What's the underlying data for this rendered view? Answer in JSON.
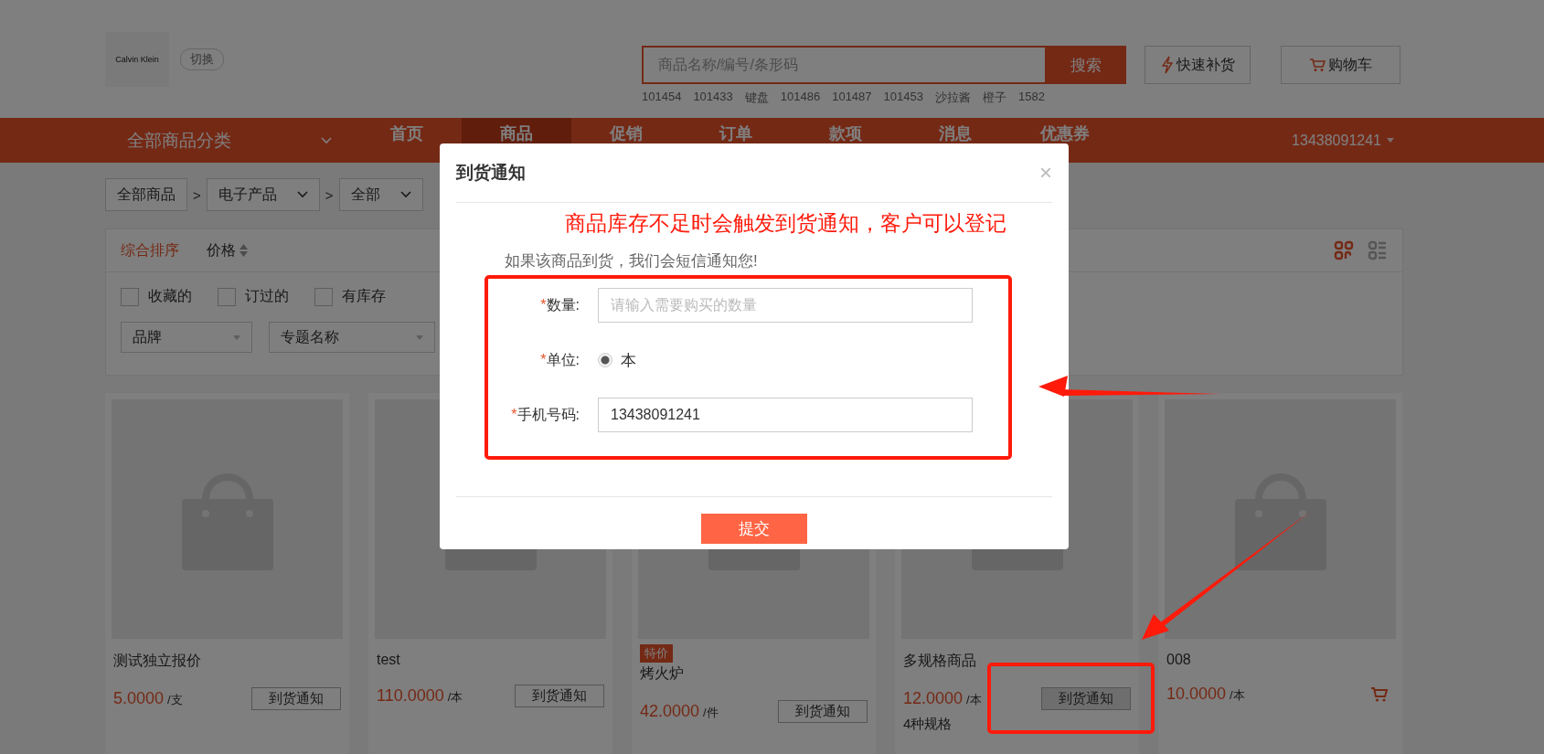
{
  "header": {
    "logo": "Calvin Klein",
    "switch_label": "切换",
    "search": {
      "placeholder": "商品名称/编号/条形码",
      "button": "搜索"
    },
    "quick_restock": "快速补货",
    "cart": "购物车",
    "hot_words": [
      "101454",
      "101433",
      "键盘",
      "101486",
      "101487",
      "101453",
      "沙拉酱",
      "橙子",
      "1582"
    ]
  },
  "nav": {
    "category": "全部商品分类",
    "items": [
      {
        "label": "首页",
        "selected": false
      },
      {
        "label": "商品",
        "selected": true
      },
      {
        "label": "促销",
        "selected": false
      },
      {
        "label": "订单",
        "selected": false
      },
      {
        "label": "款项",
        "selected": false
      },
      {
        "label": "消息",
        "selected": false
      },
      {
        "label": "优惠券",
        "selected": false
      }
    ],
    "account": "13438091241"
  },
  "breadcrumb": [
    {
      "label": "全部商品",
      "dropdown": false
    },
    {
      "label": "电子产品",
      "dropdown": true
    },
    {
      "label": "全部",
      "dropdown": true
    }
  ],
  "breadcrumb_separator": ">",
  "sort_options": [
    {
      "label": "综合排序",
      "selected": true,
      "sortable": false
    },
    {
      "label": "价格",
      "selected": false,
      "sortable": true
    }
  ],
  "view_modes": [
    {
      "kind": "grid",
      "selected": true
    },
    {
      "kind": "list",
      "selected": false
    }
  ],
  "filters": [
    {
      "label": "收藏的",
      "checked": false
    },
    {
      "label": "订过的",
      "checked": false
    },
    {
      "label": "有库存",
      "checked": false
    }
  ],
  "selects": [
    {
      "placeholder": "品牌"
    },
    {
      "placeholder": "专题名称"
    }
  ],
  "products": [
    {
      "name": "测试独立报价",
      "price": "5.0000",
      "unit": "/支",
      "action": {
        "kind": "notify",
        "label": "到货通知"
      }
    },
    {
      "name": "test",
      "price": "110.0000",
      "unit": "/本",
      "action": {
        "kind": "notify",
        "label": "到货通知"
      }
    },
    {
      "tag": "特价",
      "name": "烤火炉",
      "price": "42.0000",
      "unit": "/件",
      "action": {
        "kind": "notify",
        "label": "到货通知"
      }
    },
    {
      "name": "多规格商品",
      "price": "12.0000",
      "unit": "/本",
      "specs": "4种规格",
      "action": {
        "kind": "notify",
        "label": "到货通知",
        "hovered": true
      }
    },
    {
      "name": "008",
      "price": "10.0000",
      "unit": "/本",
      "action": {
        "kind": "cart"
      }
    }
  ],
  "dialog": {
    "title": "到货通知",
    "close": "×",
    "message": "如果该商品到货，我们会短信通知您!",
    "fields": [
      {
        "kind": "input",
        "required_mark": "*",
        "label": "数量:",
        "placeholder": "请输入需要购买的数量"
      },
      {
        "kind": "radio",
        "required_mark": "*",
        "label": "单位:",
        "options": [
          {
            "label": "本",
            "selected": true
          }
        ]
      },
      {
        "kind": "input",
        "required_mark": "*",
        "label": "手机号码:",
        "value": "13438091241"
      }
    ],
    "submit": "提交"
  },
  "annotations": {
    "note": "商品库存不足时会触发到货通知，客户可以登记"
  }
}
